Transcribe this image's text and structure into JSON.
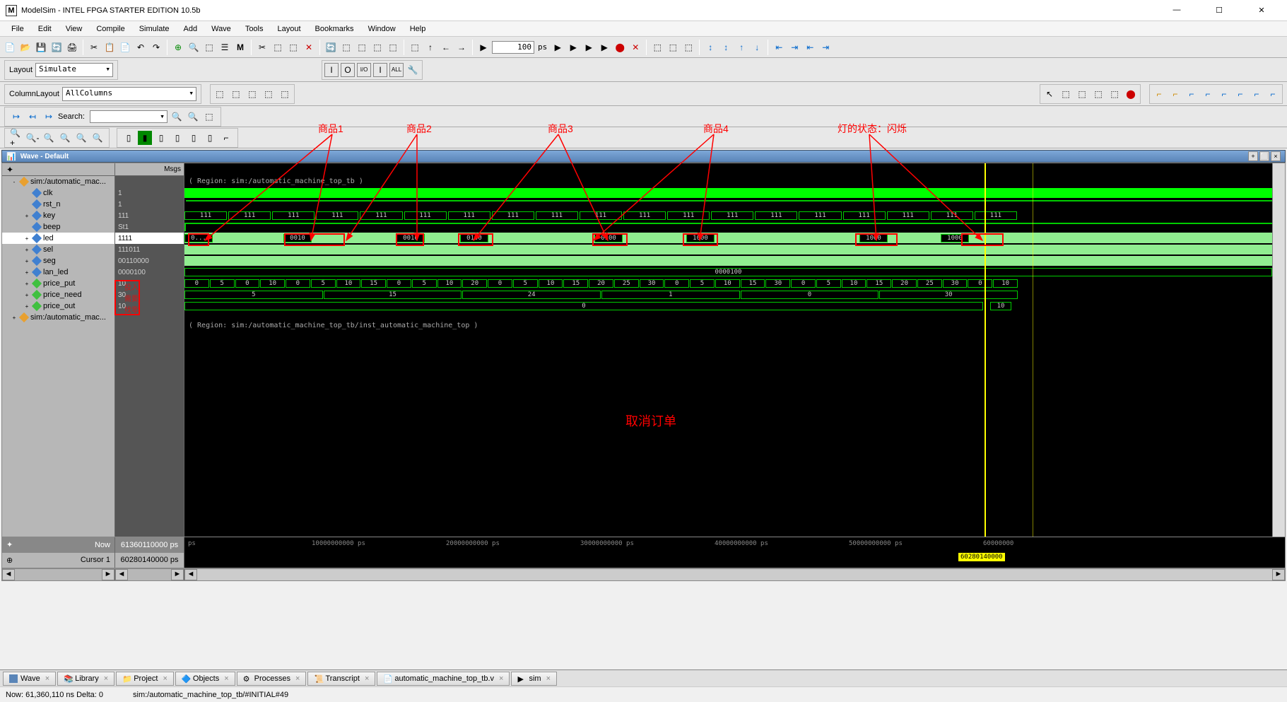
{
  "window": {
    "title": "ModelSim - INTEL FPGA STARTER EDITION 10.5b"
  },
  "menu": [
    "File",
    "Edit",
    "View",
    "Compile",
    "Simulate",
    "Add",
    "Wave",
    "Tools",
    "Layout",
    "Bookmarks",
    "Window",
    "Help"
  ],
  "layout": {
    "label": "Layout",
    "value": "Simulate"
  },
  "columnLayout": {
    "label": "ColumnLayout",
    "value": "AllColumns"
  },
  "search": {
    "label": "Search:",
    "value": ""
  },
  "time": {
    "value": "100",
    "unit": "ps"
  },
  "waveHeader": "Wave - Default",
  "msgsHeader": "Msgs",
  "signals": [
    {
      "exp": "-",
      "dia": "orange",
      "name": "sim:/automatic_mac...",
      "msg": ""
    },
    {
      "exp": "",
      "dia": "blue",
      "name": "clk",
      "msg": "1"
    },
    {
      "exp": "",
      "dia": "blue",
      "name": "rst_n",
      "msg": "1"
    },
    {
      "exp": "+",
      "dia": "blue",
      "name": "key",
      "msg": "111"
    },
    {
      "exp": "",
      "dia": "blue",
      "name": "beep",
      "msg": "St1"
    },
    {
      "exp": "+",
      "dia": "blue",
      "name": "led",
      "msg": "1111",
      "sel": true
    },
    {
      "exp": "+",
      "dia": "blue",
      "name": "sel",
      "msg": "111011"
    },
    {
      "exp": "+",
      "dia": "blue",
      "name": "seg",
      "msg": "00110000"
    },
    {
      "exp": "+",
      "dia": "blue",
      "name": "lan_led",
      "msg": "0000100"
    },
    {
      "exp": "+",
      "dia": "green",
      "name": "price_put",
      "msg": "10"
    },
    {
      "exp": "+",
      "dia": "green",
      "name": "price_need",
      "msg": "30"
    },
    {
      "exp": "+",
      "dia": "green",
      "name": "price_out",
      "msg": "10"
    },
    {
      "exp": "+",
      "dia": "orange",
      "name": "sim:/automatic_mac...",
      "msg": ""
    }
  ],
  "regions": {
    "r1": "( Region: sim:/automatic_machine_top_tb )",
    "r2": "( Region: sim:/automatic_machine_top_tb/inst_automatic_machine_top )"
  },
  "keyVals": [
    "111",
    "111",
    "111",
    "111",
    "111",
    "111",
    "111",
    "111",
    "111",
    "111",
    "111",
    "111",
    "111",
    "111",
    "111",
    "111",
    "111",
    "111",
    "111"
  ],
  "ledVals": [
    "0...",
    "0010",
    "0010",
    "0100",
    "0100",
    "1000",
    "1000",
    "1000"
  ],
  "lanVal": "0000100",
  "pricePutVals": [
    "0",
    "5",
    "0",
    "10",
    "0",
    "5",
    "10",
    "15",
    "0",
    "5",
    "10",
    "20",
    "0",
    "5",
    "10",
    "15",
    "20",
    "25",
    "30",
    "0",
    "5",
    "10",
    "15",
    "30",
    "0",
    "5",
    "10",
    "15",
    "20",
    "25",
    "30",
    "0",
    "10"
  ],
  "priceNeedVals": [
    "5",
    "15",
    "24",
    "1",
    "0",
    "30"
  ],
  "priceOutVals": [
    "0",
    "10"
  ],
  "cursor": {
    "nowLabel": "Now",
    "nowVal": "61360110000 ps",
    "c1Label": "Cursor 1",
    "c1Val": "60280140000 ps"
  },
  "timeAxis": [
    "ps",
    "10000000000 ps",
    "20000000000 ps",
    "30000000000 ps",
    "40000000000 ps",
    "50000000000 ps",
    "60000000"
  ],
  "yellowCursor": "60280140000",
  "tabs": [
    {
      "icon": "wave",
      "label": "Wave"
    },
    {
      "icon": "lib",
      "label": "Library"
    },
    {
      "icon": "proj",
      "label": "Project"
    },
    {
      "icon": "obj",
      "label": "Objects"
    },
    {
      "icon": "proc",
      "label": "Processes"
    },
    {
      "icon": "trans",
      "label": "Transcript"
    },
    {
      "icon": "file",
      "label": "automatic_machine_top_tb.v"
    },
    {
      "icon": "sim",
      "label": "sim"
    }
  ],
  "status": {
    "left": "Now: 61,360,110 ns  Delta: 0",
    "right": "sim:/automatic_machine_top_tb/#INITIAL#49"
  },
  "annotations": {
    "p1": "商品1",
    "p2": "商品2",
    "p3": "商品3",
    "p4": "商品4",
    "led": "灯的状态：闪烁",
    "cancel": "取消订单",
    "side1": "投入",
    "side2": "需要",
    "side3": "找零"
  }
}
